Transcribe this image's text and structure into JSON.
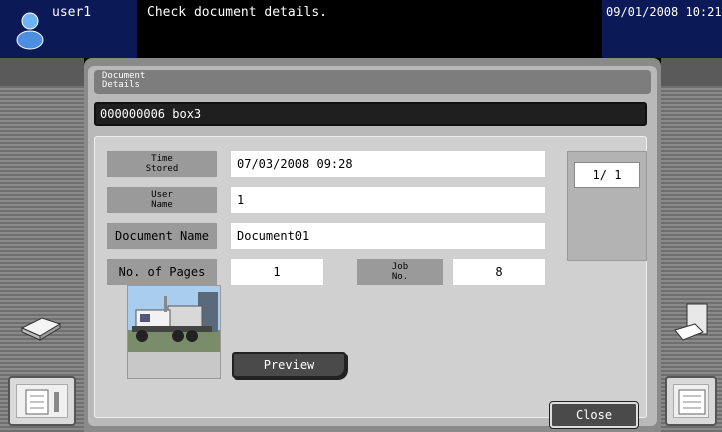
{
  "header": {
    "user": "user1",
    "message": "Check document details.",
    "datetime": "09/01/2008 10:21"
  },
  "panel": {
    "title_line1": "Document",
    "title_line2": "Details",
    "box": "000000006 box3"
  },
  "fields": {
    "time_stored_label_1": "Time",
    "time_stored_label_2": "Stored",
    "time_stored_value": "07/03/2008 09:28",
    "user_name_label_1": "User",
    "user_name_label_2": "Name",
    "user_name_value": "1",
    "document_name_label": "Document Name",
    "document_name_value": "Document01",
    "pages_label": "No. of Pages",
    "pages_value": "1",
    "job_no_label_1": "Job",
    "job_no_label_2": "No.",
    "job_no_value": "8"
  },
  "pager": {
    "text": "1/  1"
  },
  "buttons": {
    "preview": "Preview",
    "close": "Close"
  },
  "icons": {
    "user": "user-icon",
    "left_tray": "scanner-icon",
    "left_bottom": "job-list-icon",
    "right_tray": "printer-output-icon",
    "right_bottom": "settings-list-icon"
  }
}
